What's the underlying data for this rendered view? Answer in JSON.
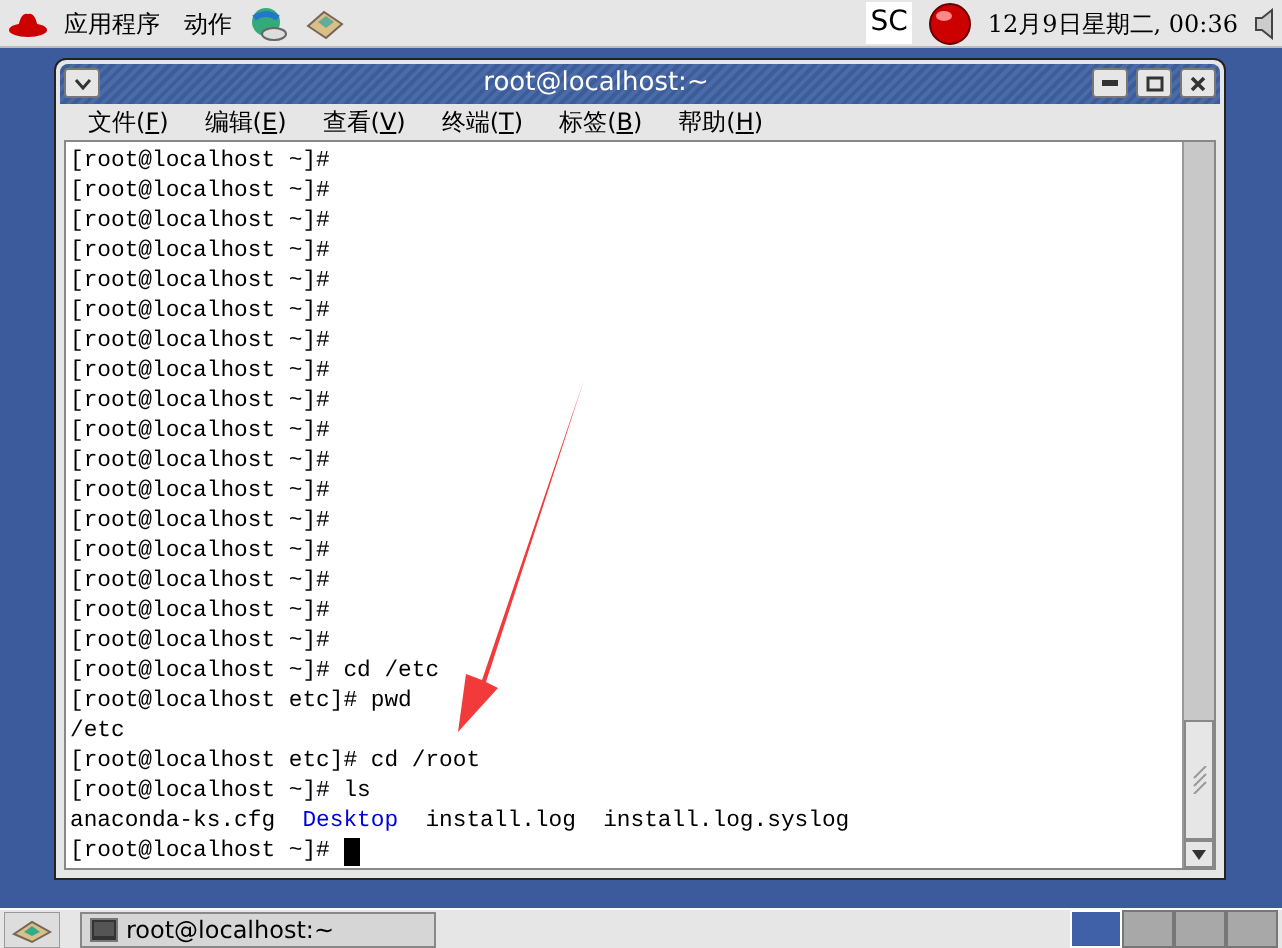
{
  "top_panel": {
    "menus": [
      "应用程序",
      "动作"
    ],
    "indicator": "SC",
    "clock": "12月9日星期二, 00:36"
  },
  "window": {
    "title": "root@localhost:~",
    "menu": [
      "文件(F)",
      "编辑(E)",
      "查看(V)",
      "终端(T)",
      "标签(B)",
      "帮助(H)"
    ],
    "terminal": [
      {
        "text": "[root@localhost ~]#"
      },
      {
        "text": "[root@localhost ~]#"
      },
      {
        "text": "[root@localhost ~]#"
      },
      {
        "text": "[root@localhost ~]#"
      },
      {
        "text": "[root@localhost ~]#"
      },
      {
        "text": "[root@localhost ~]#"
      },
      {
        "text": "[root@localhost ~]#"
      },
      {
        "text": "[root@localhost ~]#"
      },
      {
        "text": "[root@localhost ~]#"
      },
      {
        "text": "[root@localhost ~]#"
      },
      {
        "text": "[root@localhost ~]#"
      },
      {
        "text": "[root@localhost ~]#"
      },
      {
        "text": "[root@localhost ~]#"
      },
      {
        "text": "[root@localhost ~]#"
      },
      {
        "text": "[root@localhost ~]#"
      },
      {
        "text": "[root@localhost ~]#"
      },
      {
        "text": "[root@localhost ~]#"
      },
      {
        "text": "[root@localhost ~]# cd /etc"
      },
      {
        "text": "[root@localhost etc]# pwd"
      },
      {
        "text": "/etc"
      },
      {
        "text": "[root@localhost etc]# cd /root"
      },
      {
        "text": "[root@localhost ~]# ls"
      },
      {
        "entries": [
          {
            "text": "anaconda-ks.cfg",
            "kind": "file"
          },
          {
            "text": "Desktop",
            "kind": "dir"
          },
          {
            "text": "install.log",
            "kind": "file"
          },
          {
            "text": "install.log.syslog",
            "kind": "file"
          }
        ]
      },
      {
        "text": "[root@localhost ~]#",
        "cursor": true
      }
    ]
  },
  "taskbar": {
    "task": "root@localhost:~",
    "workspaces": [
      {
        "selected": true
      },
      {
        "selected": false
      },
      {
        "selected": false
      },
      {
        "selected": false
      }
    ]
  }
}
